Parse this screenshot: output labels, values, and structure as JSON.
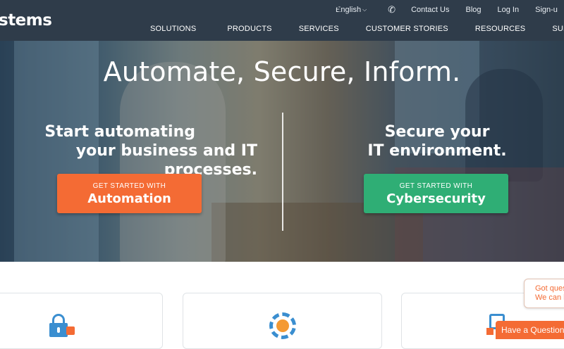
{
  "header": {
    "logo_text": "stems",
    "utility": {
      "language": "English",
      "links": [
        "Contact Us",
        "Blog",
        "Log In",
        "Sign-u"
      ]
    },
    "nav": [
      "SOLUTIONS",
      "PRODUCTS",
      "SERVICES",
      "CUSTOMER STORIES",
      "RESOURCES",
      "SUPPORT"
    ]
  },
  "hero": {
    "headline": "Automate, Secure, Inform.",
    "left": {
      "line1": "Start automating",
      "line2": "your business and IT processes.",
      "button_small": "GET STARTED WITH",
      "button_big": "Automation"
    },
    "right": {
      "line1": "Secure your",
      "line2": "IT environment.",
      "button_small": "GET STARTED WITH",
      "button_big": "Cybersecurity"
    }
  },
  "chat": {
    "bubble_line1": "Got ques",
    "bubble_line2": "We can h",
    "button": "Have a Question?"
  },
  "colors": {
    "header_bg": "#2f3c4a",
    "accent_orange": "#f46b34",
    "accent_green": "#2fae75",
    "icon_blue": "#3a8ed0"
  }
}
